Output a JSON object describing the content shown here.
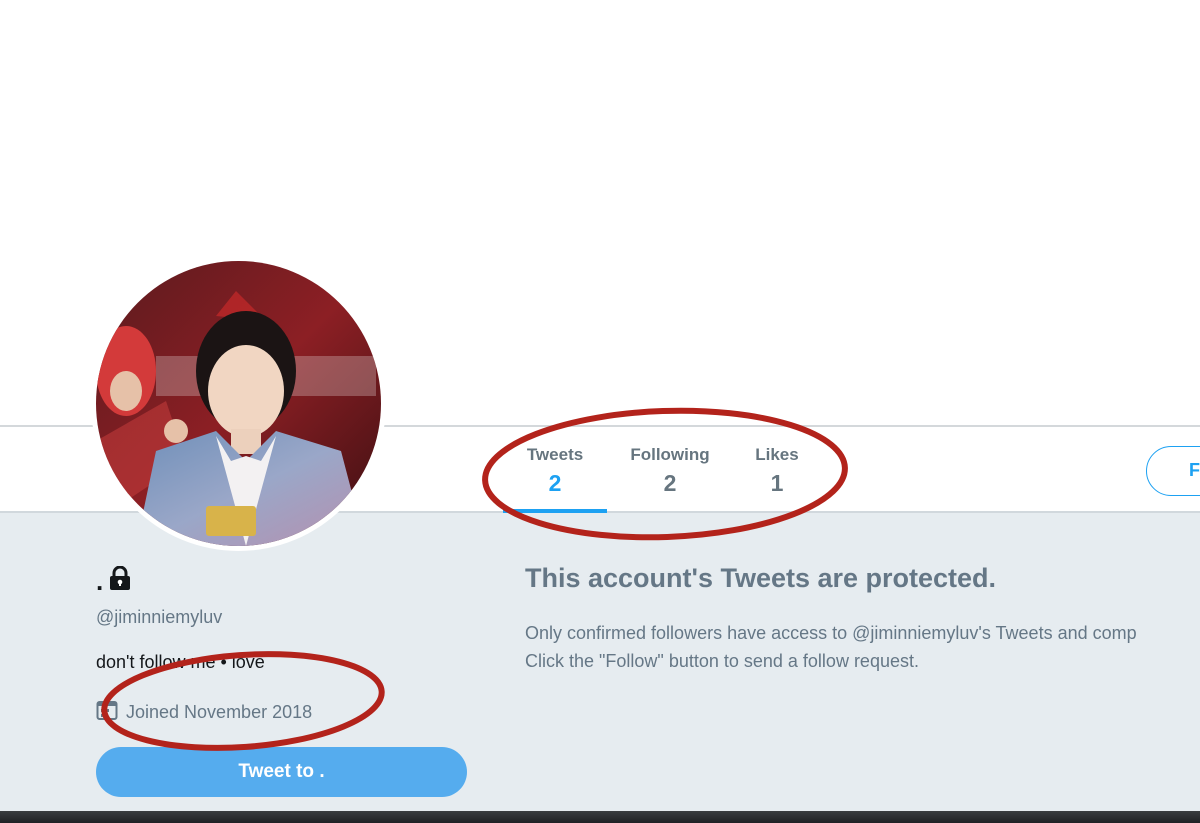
{
  "profile": {
    "display_name": ".",
    "handle": "@jiminniemyluv",
    "bio": "don't follow me • love",
    "joined": "Joined November 2018",
    "tweet_to_label": "Tweet to ."
  },
  "nav": {
    "items": [
      {
        "label": "Tweets",
        "value": "2"
      },
      {
        "label": "Following",
        "value": "2"
      },
      {
        "label": "Likes",
        "value": "1"
      }
    ],
    "follow_label": "F"
  },
  "protected": {
    "heading": "This account's Tweets are protected.",
    "line1": "Only confirmed followers have access to @jiminniemyluv's Tweets and comp",
    "line2": "Click the \"Follow\" button to send a follow request."
  },
  "colors": {
    "accent": "#1da1f2",
    "tweet_button": "#55acee",
    "background": "#e6ecf0",
    "annotation": "#b3231b"
  },
  "icons": [
    "lock-icon",
    "calendar-icon"
  ]
}
